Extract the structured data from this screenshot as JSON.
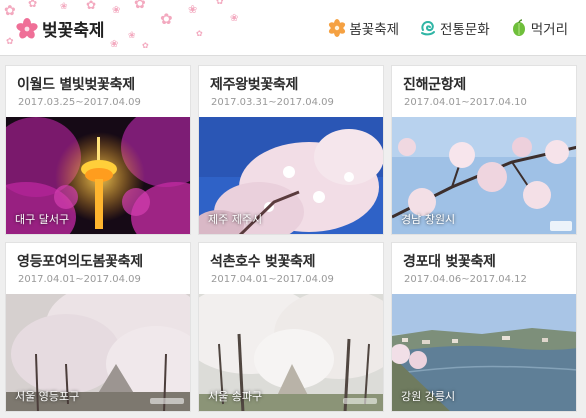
{
  "header": {
    "title": "벚꽃축제",
    "nav": [
      {
        "label": "봄꽃축제",
        "icon": "orange-flower-icon"
      },
      {
        "label": "전통문화",
        "icon": "swirl-icon"
      },
      {
        "label": "먹거리",
        "icon": "green-leaf-icon"
      }
    ]
  },
  "colors": {
    "petal": "#f3a9bf",
    "nav_flower": "#f5a142",
    "nav_swirl": "#2fb5a5",
    "nav_leaf": "#6fbf3b"
  },
  "festivals": [
    {
      "name": "이월드 별빛벚꽃축제",
      "date": "2017.03.25~2017.04.09",
      "location": "대구 달서구",
      "photo": "night-tower-cherry-blossom"
    },
    {
      "name": "제주왕벚꽃축제",
      "date": "2017.03.31~2017.04.09",
      "location": "제주 제주시",
      "photo": "blue-sky-cherry-blossom"
    },
    {
      "name": "진해군항제",
      "date": "2017.04.01~2017.04.10",
      "location": "경남 창원시",
      "photo": "sky-cherry-blossom-branches"
    },
    {
      "name": "영등포여의도봄꽃축제",
      "date": "2017.04.01~2017.04.09",
      "location": "서울 영등포구",
      "photo": "cherry-blossom-road"
    },
    {
      "name": "석촌호수 벚꽃축제",
      "date": "2017.04.01~2017.04.09",
      "location": "서울 송파구",
      "photo": "cherry-blossom-path"
    },
    {
      "name": "경포대 벚꽃축제",
      "date": "2017.04.06~2017.04.12",
      "location": "강원 강릉시",
      "photo": "lake-shore-town"
    }
  ]
}
